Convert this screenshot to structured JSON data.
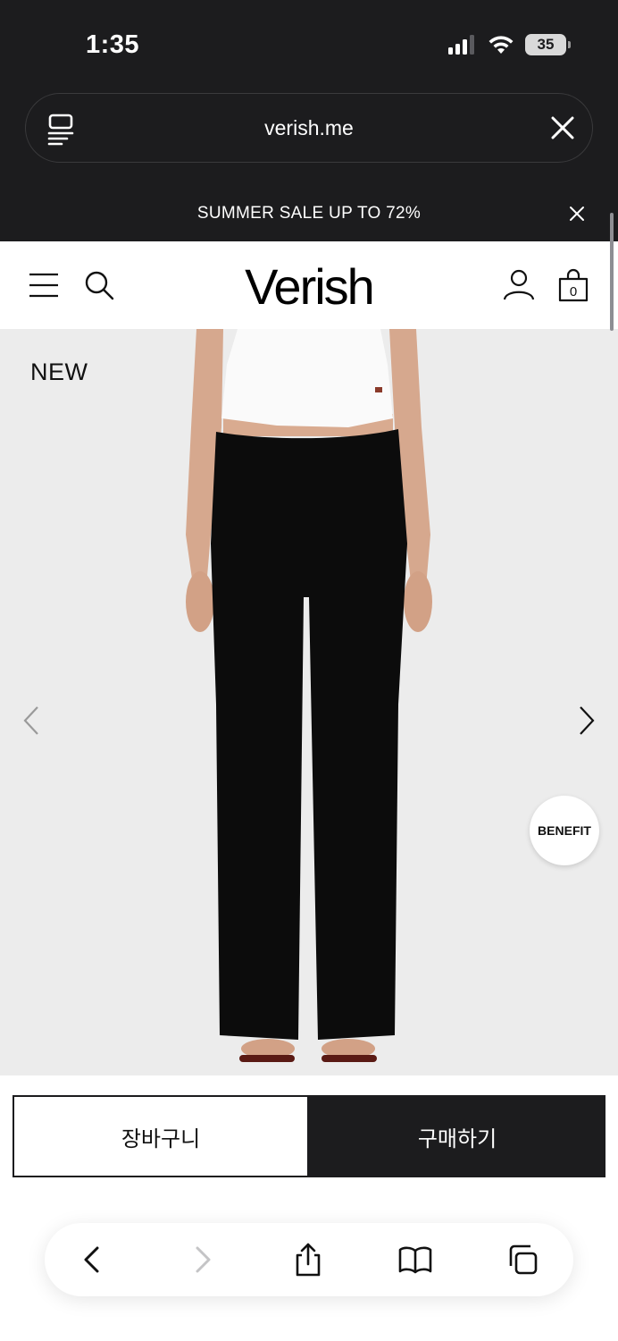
{
  "status_bar": {
    "time": "1:35",
    "battery": "35",
    "icons": [
      "signal-icon",
      "wifi-icon",
      "battery-icon"
    ]
  },
  "address_bar": {
    "url": "verish.me",
    "icons": [
      "reader-mode-icon",
      "close-icon"
    ]
  },
  "promo_banner": {
    "text": "SUMMER SALE UP TO 72%",
    "icons": [
      "close-icon"
    ]
  },
  "header": {
    "logo": "Verish",
    "cart_count": "0",
    "icons": [
      "menu-icon",
      "search-icon",
      "account-icon",
      "shopping-bag-icon"
    ]
  },
  "product": {
    "badge": "NEW",
    "benefit_label": "BENEFIT",
    "icons": [
      "chevron-left-icon",
      "chevron-right-icon"
    ]
  },
  "actions": {
    "add_to_cart": "장바구니",
    "buy_now": "구매하기"
  },
  "browser_toolbar": {
    "icons": [
      "back-icon",
      "forward-icon",
      "share-icon",
      "bookmarks-icon",
      "tabs-icon"
    ]
  },
  "colors": {
    "chrome_dark": "#1c1c1e",
    "product_bg": "#ececec",
    "white": "#ffffff"
  }
}
